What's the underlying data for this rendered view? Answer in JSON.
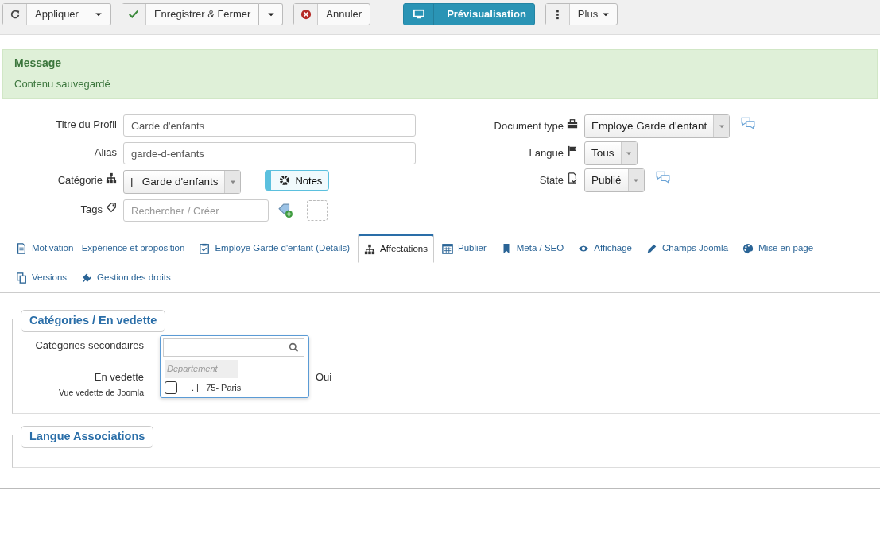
{
  "toolbar": [
    {
      "label": "Appliquer",
      "kind": "split"
    },
    {
      "label": "Enregistrer & Fermer",
      "kind": "split"
    },
    {
      "label": "Annuler",
      "kind": "plain"
    },
    {
      "label": "Prévisualisation",
      "kind": "primary"
    },
    {
      "label": "Plus",
      "kind": "menu"
    }
  ],
  "message": {
    "heading": "Message",
    "text": "Contenu sauvegardé"
  },
  "left_fields": [
    {
      "label": "Titre du Profil",
      "kind": "text",
      "value": "Garde d'enfants"
    },
    {
      "label": "Alias",
      "kind": "text",
      "value": "garde-d-enfants"
    },
    {
      "label": "Catégorie",
      "kind": "select",
      "value": "|_ Garde d'enfants",
      "button": "Notes"
    },
    {
      "label": "Tags",
      "kind": "tags",
      "placeholder": "Rechercher / Créer"
    }
  ],
  "right_fields": [
    {
      "label": "Document type",
      "value": "Employe Garde d'entant",
      "comments": true
    },
    {
      "label": "Langue",
      "value": "Tous",
      "comments": false
    },
    {
      "label": "State",
      "value": "Publié",
      "comments": true
    }
  ],
  "tabs": [
    {
      "label": "Motivation - Expérience et proposition",
      "selected": false
    },
    {
      "label": "Employe Garde d'entant (Détails)",
      "selected": false
    },
    {
      "label": "Affectations",
      "selected": true
    },
    {
      "label": "Publier",
      "selected": false
    },
    {
      "label": "Meta / SEO",
      "selected": false
    },
    {
      "label": "Affichage",
      "selected": false
    },
    {
      "label": "Champs Joomla",
      "selected": false
    },
    {
      "label": "Mise en page",
      "selected": false
    },
    {
      "label": "Versions",
      "selected": false
    },
    {
      "label": "Gestion des droits",
      "selected": false
    }
  ],
  "fieldset1": {
    "legend": "Catégories / En vedette",
    "secondary_label": "Catégories secondaires",
    "featured_label": "En vedette",
    "featured_desc": "Vue vedette de Joomla",
    "featured_value": "Oui",
    "dropdown": {
      "group": "Departement",
      "options": [
        {
          "label": ". |_ 75- Paris",
          "checked": false
        }
      ]
    }
  },
  "fieldset2": {
    "legend": "Langue Associations"
  }
}
